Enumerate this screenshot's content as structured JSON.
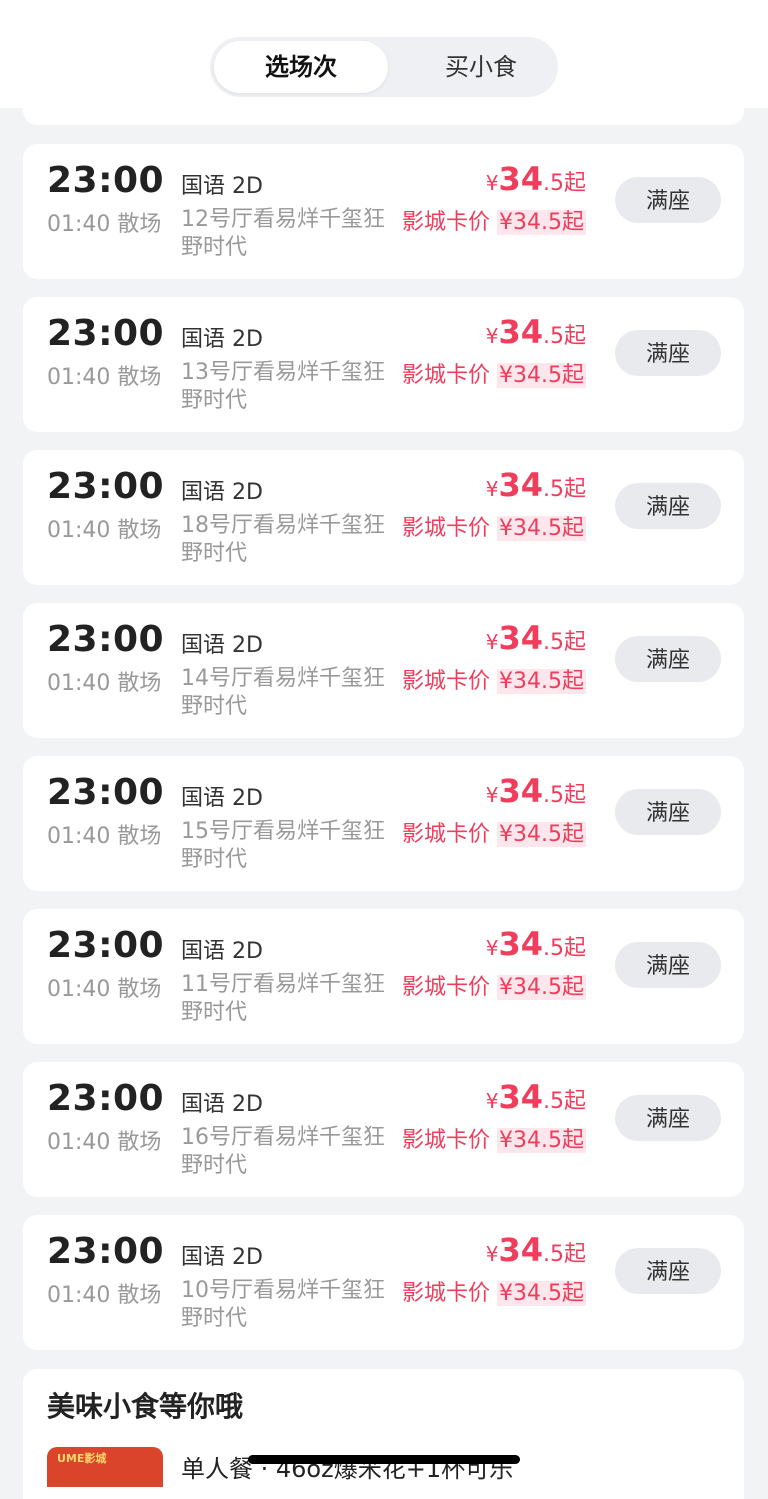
{
  "tabs": {
    "showtimes": "选场次",
    "snacks": "买小食"
  },
  "showtimes": [
    {
      "start": "23:00",
      "end": "01:40 散场",
      "language": "国语 2D",
      "hall": "12号厅看易烊千玺狂野时代",
      "currency": "¥",
      "price_int": "34",
      "price_dec": ".5",
      "price_suffix": "起",
      "card_label": "影城卡价",
      "card_value": "¥34.5起",
      "status": "满座"
    },
    {
      "start": "23:00",
      "end": "01:40 散场",
      "language": "国语 2D",
      "hall": "13号厅看易烊千玺狂野时代",
      "currency": "¥",
      "price_int": "34",
      "price_dec": ".5",
      "price_suffix": "起",
      "card_label": "影城卡价",
      "card_value": "¥34.5起",
      "status": "满座"
    },
    {
      "start": "23:00",
      "end": "01:40 散场",
      "language": "国语 2D",
      "hall": "18号厅看易烊千玺狂野时代",
      "currency": "¥",
      "price_int": "34",
      "price_dec": ".5",
      "price_suffix": "起",
      "card_label": "影城卡价",
      "card_value": "¥34.5起",
      "status": "满座"
    },
    {
      "start": "23:00",
      "end": "01:40 散场",
      "language": "国语 2D",
      "hall": "14号厅看易烊千玺狂野时代",
      "currency": "¥",
      "price_int": "34",
      "price_dec": ".5",
      "price_suffix": "起",
      "card_label": "影城卡价",
      "card_value": "¥34.5起",
      "status": "满座"
    },
    {
      "start": "23:00",
      "end": "01:40 散场",
      "language": "国语 2D",
      "hall": "15号厅看易烊千玺狂野时代",
      "currency": "¥",
      "price_int": "34",
      "price_dec": ".5",
      "price_suffix": "起",
      "card_label": "影城卡价",
      "card_value": "¥34.5起",
      "status": "满座"
    },
    {
      "start": "23:00",
      "end": "01:40 散场",
      "language": "国语 2D",
      "hall": "11号厅看易烊千玺狂野时代",
      "currency": "¥",
      "price_int": "34",
      "price_dec": ".5",
      "price_suffix": "起",
      "card_label": "影城卡价",
      "card_value": "¥34.5起",
      "status": "满座"
    },
    {
      "start": "23:00",
      "end": "01:40 散场",
      "language": "国语 2D",
      "hall": "16号厅看易烊千玺狂野时代",
      "currency": "¥",
      "price_int": "34",
      "price_dec": ".5",
      "price_suffix": "起",
      "card_label": "影城卡价",
      "card_value": "¥34.5起",
      "status": "满座"
    },
    {
      "start": "23:00",
      "end": "01:40 散场",
      "language": "国语 2D",
      "hall": "10号厅看易烊千玺狂野时代",
      "currency": "¥",
      "price_int": "34",
      "price_dec": ".5",
      "price_suffix": "起",
      "card_label": "影城卡价",
      "card_value": "¥34.5起",
      "status": "满座"
    }
  ],
  "snacks": {
    "title": "美味小食等你哦",
    "item_brand": "UME影城",
    "item_name": "单人餐 · 46oz爆米花+1杯可乐"
  },
  "colors": {
    "accent": "#f03d5c",
    "background": "#f2f3f5"
  }
}
